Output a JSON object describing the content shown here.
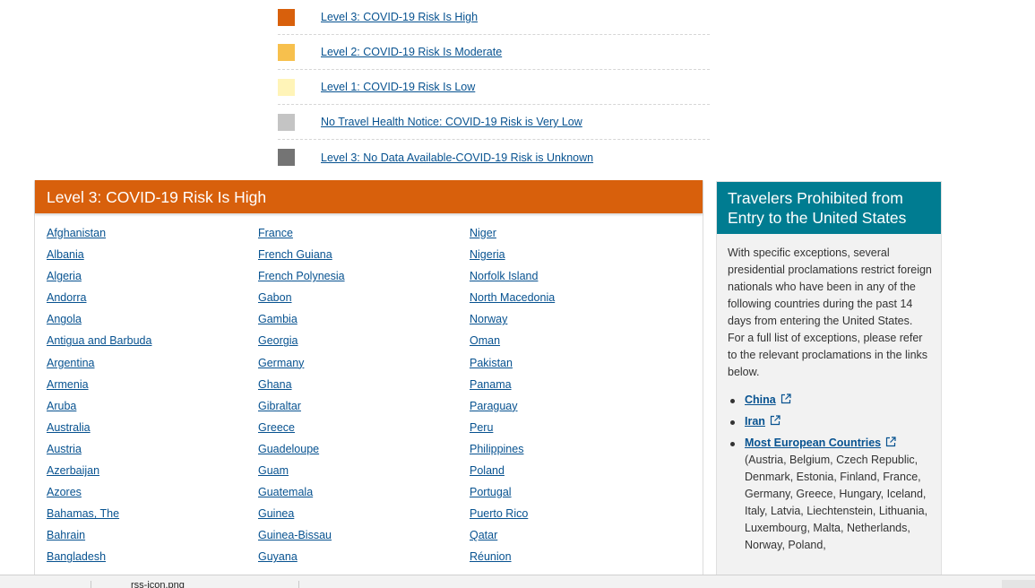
{
  "legend": [
    {
      "label": "Level 3: COVID-19 Risk Is High",
      "color": "#d8600c"
    },
    {
      "label": "Level 2: COVID-19 Risk Is Moderate",
      "color": "#f7c04d"
    },
    {
      "label": "Level 1: COVID-19 Risk Is Low",
      "color": "#fff4b8"
    },
    {
      "label": "No Travel Health Notice: COVID-19 Risk is Very Low",
      "color": "#c4c4c4"
    },
    {
      "label": "Level 3: No Data Available-COVID-19 Risk is Unknown",
      "color": "#747474"
    }
  ],
  "level_card": {
    "title": "Level 3: COVID-19 Risk Is High",
    "columns": [
      [
        "Afghanistan",
        "Albania",
        "Algeria",
        "Andorra",
        "Angola",
        "Antigua and Barbuda",
        "Argentina",
        "Armenia",
        "Aruba",
        "Australia",
        "Austria",
        "Azerbaijan",
        "Azores",
        "Bahamas, The",
        "Bahrain",
        "Bangladesh"
      ],
      [
        "France",
        "French Guiana",
        "French Polynesia",
        "Gabon",
        "Gambia",
        "Georgia",
        "Germany",
        "Ghana",
        "Gibraltar",
        "Greece",
        "Guadeloupe",
        "Guam",
        "Guatemala",
        "Guinea",
        "Guinea-Bissau",
        "Guyana"
      ],
      [
        "Niger",
        "Nigeria",
        "Norfolk Island",
        "North Macedonia",
        "Norway",
        "Oman",
        "Pakistan",
        "Panama",
        "Paraguay",
        "Peru",
        "Philippines",
        "Poland",
        "Portugal",
        "Puerto Rico",
        "Qatar",
        "Réunion"
      ]
    ]
  },
  "side_card": {
    "title": "Travelers Prohibited from Entry to the United States",
    "intro": "With specific exceptions, several presidential proclamations restrict foreign nationals who have been in any of the following countries during the past 14 days from entering the United States. For a full list of exceptions, please refer to the relevant proclamations in the links below.",
    "items": [
      {
        "label": "China",
        "detail": ""
      },
      {
        "label": "Iran",
        "detail": ""
      },
      {
        "label": "Most European Countries",
        "detail": "(Austria, Belgium, Czech Republic, Denmark, Estonia, Finland, France, Germany, Greece, Hungary, Iceland, Italy, Latvia, Liechtenstein, Lithuania, Luxembourg, Malta, Netherlands, Norway, Poland,"
      }
    ],
    "icon": "external-link-icon"
  },
  "download_bar": {
    "file_name": "rss-icon.png"
  }
}
